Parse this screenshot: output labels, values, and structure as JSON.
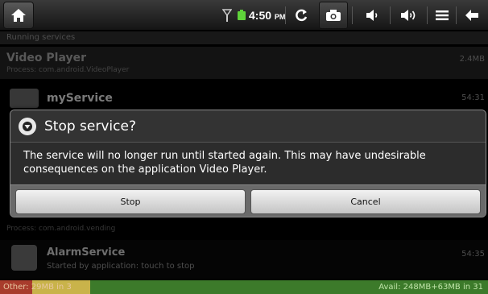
{
  "status_bar": {
    "time": "4:50",
    "ampm": "PM",
    "icons": [
      "home-icon",
      "signal-icon",
      "battery-icon",
      "refresh-icon",
      "camera-icon",
      "volume-down-icon",
      "volume-up-icon",
      "menu-icon",
      "back-icon"
    ]
  },
  "list": {
    "header": "Running services",
    "items": [
      {
        "title": "Video Player",
        "subtitle": "Process: com.android.VideoPlayer",
        "size": "2.4MB"
      },
      {
        "title": "myService",
        "time": "54:31"
      },
      {
        "title": "",
        "subtitle": "Process: com.android.vending"
      },
      {
        "title": "AlarmService",
        "subtitle": "Started by application: touch to stop",
        "time": "54:35"
      }
    ]
  },
  "memory": {
    "other": "Other: 29MB in 3",
    "avail": "Avail: 248MB+63MB in 31",
    "colors": {
      "other": "#a83c2c",
      "used": "#c9b34a",
      "avail": "#3c7a2a"
    }
  },
  "dialog": {
    "title": "Stop service?",
    "message": "The service will no longer run until started again. This may have undesirable consequences on the application Video Player.",
    "buttons": {
      "stop": "Stop",
      "cancel": "Cancel"
    }
  }
}
